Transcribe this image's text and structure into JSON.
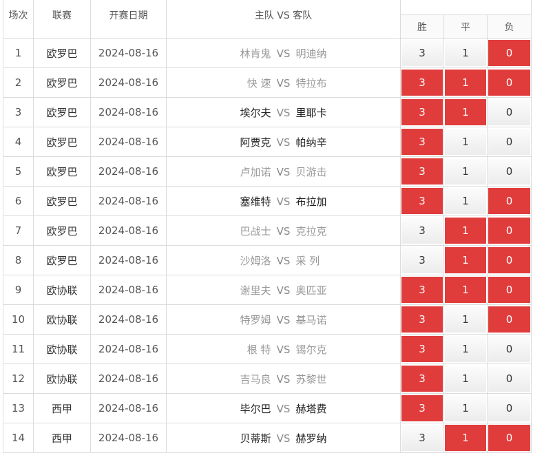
{
  "headers": {
    "round": "场次",
    "league": "联赛",
    "date": "开赛日期",
    "match": "主队 VS 客队",
    "win": "胜",
    "draw": "平",
    "lose": "负"
  },
  "colors": {
    "selected": "#e13c3c",
    "unselected_top": "#fcfcfc",
    "unselected_bottom": "#ececec"
  },
  "rows": [
    {
      "no": "1",
      "league": "欧罗巴",
      "date": "2024-08-16",
      "home": "林肯鬼",
      "vs": "VS",
      "away": "明迪纳",
      "home_strong": false,
      "away_strong": false,
      "opts": [
        "3",
        "1",
        "0"
      ],
      "sel": [
        false,
        false,
        true
      ]
    },
    {
      "no": "2",
      "league": "欧罗巴",
      "date": "2024-08-16",
      "home": "快 速",
      "vs": "VS",
      "away": "特拉布",
      "home_strong": false,
      "away_strong": false,
      "opts": [
        "3",
        "1",
        "0"
      ],
      "sel": [
        true,
        true,
        true
      ]
    },
    {
      "no": "3",
      "league": "欧罗巴",
      "date": "2024-08-16",
      "home": "埃尔夫",
      "vs": "VS",
      "away": "里耶卡",
      "home_strong": true,
      "away_strong": true,
      "opts": [
        "3",
        "1",
        "0"
      ],
      "sel": [
        true,
        true,
        false
      ]
    },
    {
      "no": "4",
      "league": "欧罗巴",
      "date": "2024-08-16",
      "home": "阿贾克",
      "vs": "VS",
      "away": "帕纳辛",
      "home_strong": true,
      "away_strong": true,
      "opts": [
        "3",
        "1",
        "0"
      ],
      "sel": [
        true,
        false,
        false
      ]
    },
    {
      "no": "5",
      "league": "欧罗巴",
      "date": "2024-08-16",
      "home": "卢加诺",
      "vs": "VS",
      "away": "贝游击",
      "home_strong": false,
      "away_strong": false,
      "opts": [
        "3",
        "1",
        "0"
      ],
      "sel": [
        true,
        false,
        false
      ]
    },
    {
      "no": "6",
      "league": "欧罗巴",
      "date": "2024-08-16",
      "home": "塞维特",
      "vs": "VS",
      "away": "布拉加",
      "home_strong": true,
      "away_strong": true,
      "opts": [
        "3",
        "1",
        "0"
      ],
      "sel": [
        true,
        false,
        true
      ]
    },
    {
      "no": "7",
      "league": "欧罗巴",
      "date": "2024-08-16",
      "home": "巴战士",
      "vs": "VS",
      "away": "克拉克",
      "home_strong": false,
      "away_strong": false,
      "opts": [
        "3",
        "1",
        "0"
      ],
      "sel": [
        false,
        true,
        true
      ]
    },
    {
      "no": "8",
      "league": "欧罗巴",
      "date": "2024-08-16",
      "home": "沙姆洛",
      "vs": "VS",
      "away": "采 列",
      "home_strong": false,
      "away_strong": false,
      "opts": [
        "3",
        "1",
        "0"
      ],
      "sel": [
        false,
        true,
        true
      ]
    },
    {
      "no": "9",
      "league": "欧协联",
      "date": "2024-08-16",
      "home": "谢里夫",
      "vs": "VS",
      "away": "奥匹亚",
      "home_strong": false,
      "away_strong": false,
      "opts": [
        "3",
        "1",
        "0"
      ],
      "sel": [
        true,
        true,
        true
      ]
    },
    {
      "no": "10",
      "league": "欧协联",
      "date": "2024-08-16",
      "home": "特罗姆",
      "vs": "VS",
      "away": "基马诺",
      "home_strong": false,
      "away_strong": false,
      "opts": [
        "3",
        "1",
        "0"
      ],
      "sel": [
        true,
        false,
        true
      ]
    },
    {
      "no": "11",
      "league": "欧协联",
      "date": "2024-08-16",
      "home": "根 特",
      "vs": "VS",
      "away": "锡尔克",
      "home_strong": false,
      "away_strong": false,
      "opts": [
        "3",
        "1",
        "0"
      ],
      "sel": [
        true,
        false,
        false
      ]
    },
    {
      "no": "12",
      "league": "欧协联",
      "date": "2024-08-16",
      "home": "吉马良",
      "vs": "VS",
      "away": "苏黎世",
      "home_strong": false,
      "away_strong": false,
      "opts": [
        "3",
        "1",
        "0"
      ],
      "sel": [
        true,
        false,
        false
      ]
    },
    {
      "no": "13",
      "league": "西甲",
      "date": "2024-08-16",
      "home": "毕尔巴",
      "vs": "VS",
      "away": "赫塔费",
      "home_strong": true,
      "away_strong": true,
      "opts": [
        "3",
        "1",
        "0"
      ],
      "sel": [
        true,
        false,
        false
      ]
    },
    {
      "no": "14",
      "league": "西甲",
      "date": "2024-08-16",
      "home": "贝蒂斯",
      "vs": "VS",
      "away": "赫罗纳",
      "home_strong": true,
      "away_strong": true,
      "opts": [
        "3",
        "1",
        "0"
      ],
      "sel": [
        false,
        true,
        true
      ]
    }
  ]
}
